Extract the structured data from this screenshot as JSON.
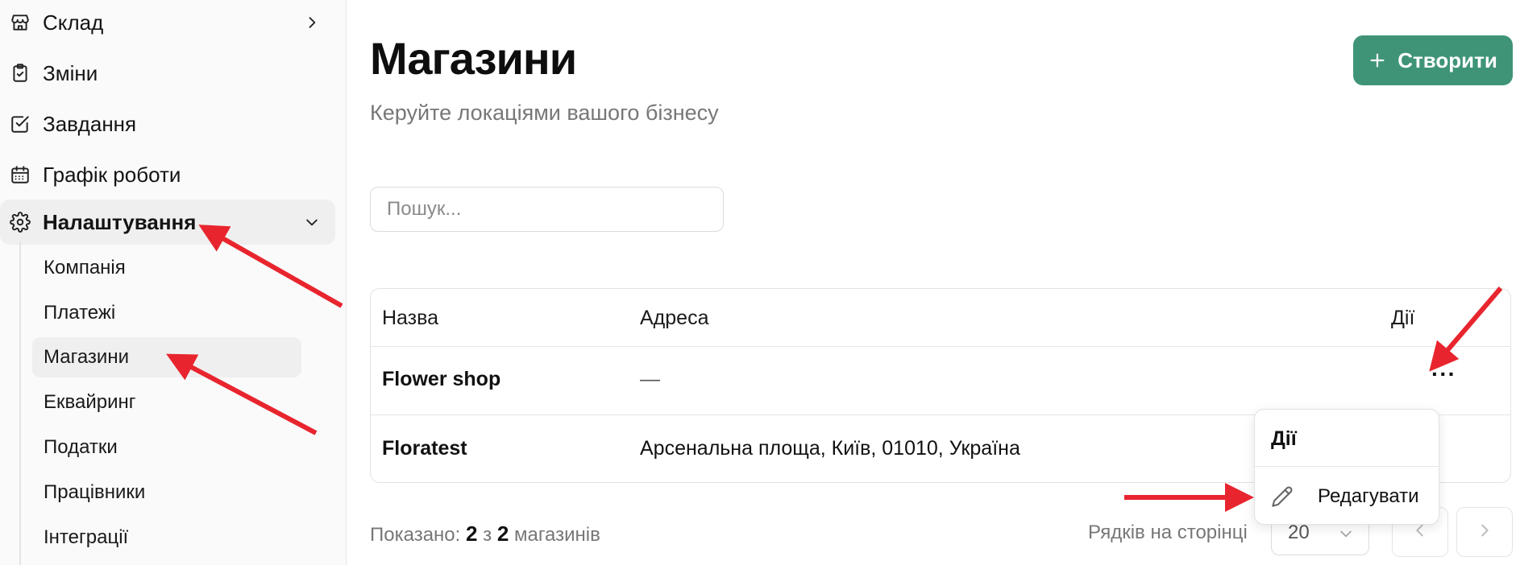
{
  "sidebar": {
    "items": [
      {
        "label": "Склад",
        "icon": "store-icon"
      },
      {
        "label": "Зміни",
        "icon": "clipboard-check-icon"
      },
      {
        "label": "Завдання",
        "icon": "checkbox-icon"
      },
      {
        "label": "Графік роботи",
        "icon": "calendar-icon"
      },
      {
        "label": "Налаштування",
        "icon": "gear-icon"
      }
    ],
    "subitems": [
      "Компанія",
      "Платежі",
      "Магазини",
      "Еквайринг",
      "Податки",
      "Працівники",
      "Інтеграції"
    ]
  },
  "header": {
    "title": "Магазини",
    "subtitle": "Керуйте локаціями вашого бізнесу",
    "create_label": "Створити"
  },
  "search": {
    "placeholder": "Пошук..."
  },
  "table": {
    "columns": [
      "Назва",
      "Адреса",
      "Дії"
    ],
    "rows": [
      {
        "name": "Flower shop",
        "address": "—",
        "actions": "···"
      },
      {
        "name": "Floratest",
        "address": "Арсенальна площа, Київ, 01010, Україна"
      }
    ]
  },
  "footer": {
    "shown_prefix": "Показано:",
    "shown_count": "2",
    "shown_of": "з",
    "shown_total": "2",
    "shown_suffix": "магазинів",
    "rows_label": "Рядків на сторінці",
    "page_size": "20"
  },
  "dropdown": {
    "header": "Дії",
    "edit_label": "Редагувати"
  },
  "colors": {
    "accent": "#3f9477",
    "annotation": "#e8252e"
  }
}
